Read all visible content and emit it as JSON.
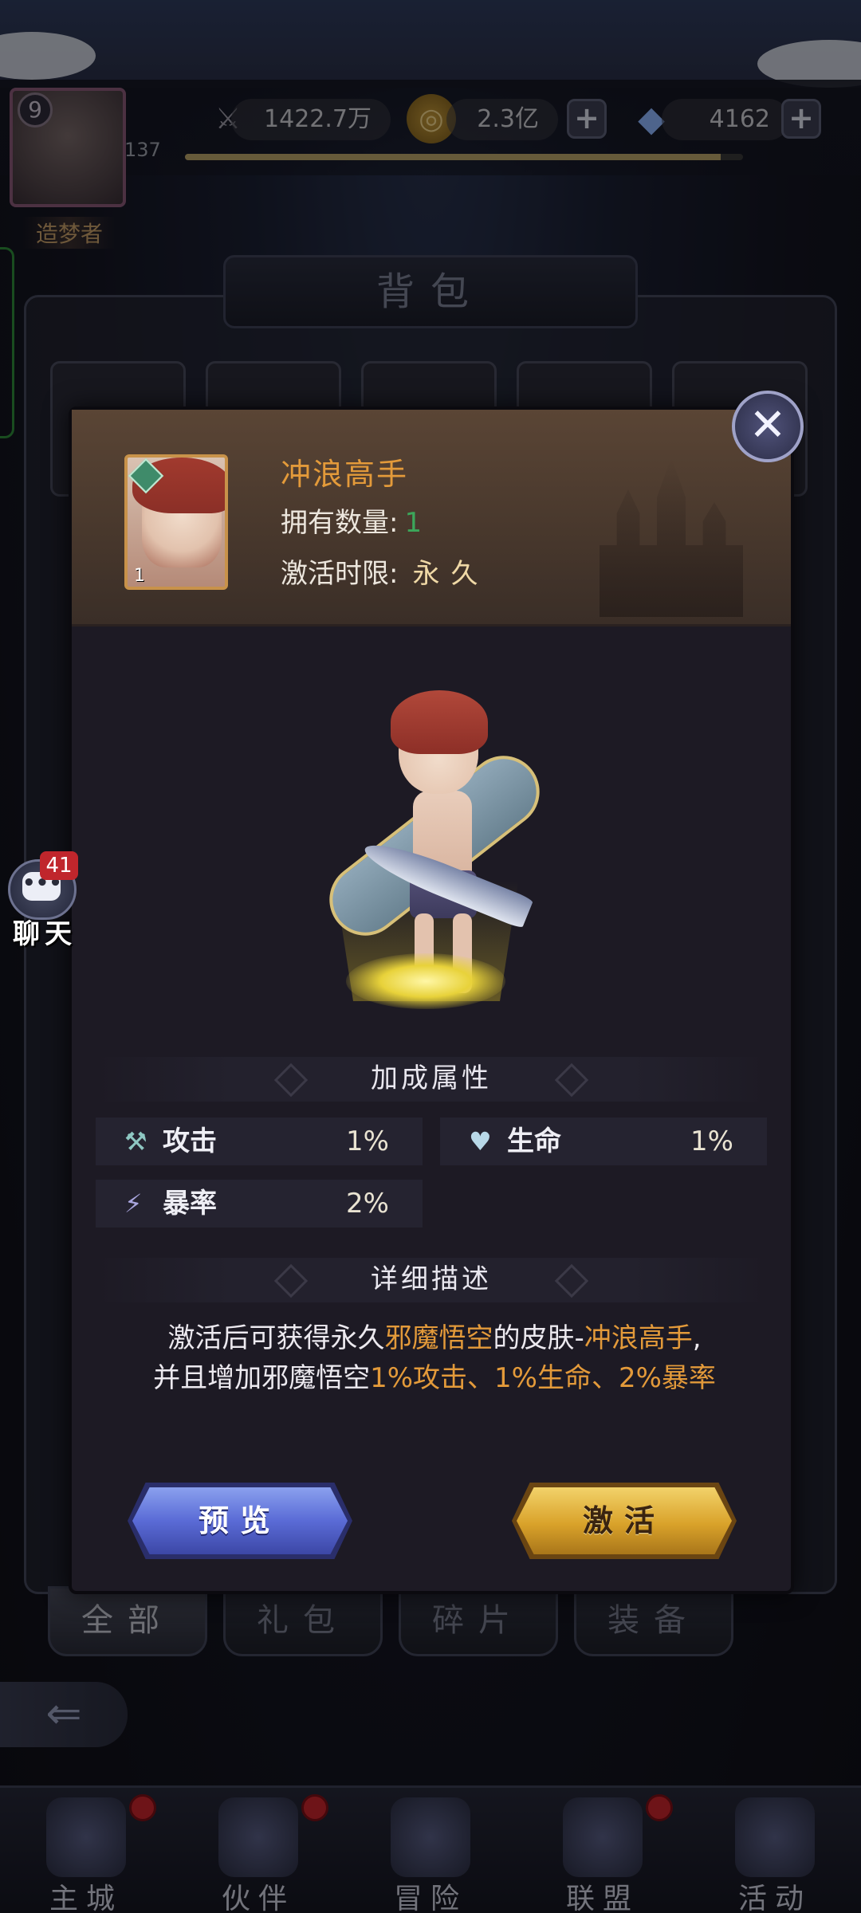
{
  "top_bar": {
    "level": "9",
    "exp_value": "137",
    "exp_progress": 0.96,
    "title_label": "造梦者",
    "power_value": "1422.7万",
    "gold_value": "2.3亿",
    "gem_value": "4162",
    "plus_symbol": "+"
  },
  "bag": {
    "title": "背包",
    "tabs": [
      "全部",
      "礼包",
      "碎片",
      "装备"
    ],
    "back_symbol": "⇐"
  },
  "chat": {
    "badge": "41",
    "label": "聊天",
    "glyph": "•••"
  },
  "modal": {
    "close_symbol": "✕",
    "item_name": "冲浪高手",
    "item_count": "1",
    "own_label": "拥有数量:",
    "own_value": "1",
    "limit_label": "激活时限:",
    "limit_value": "永久",
    "attr_section_title": "加成属性",
    "stats": [
      {
        "label": "攻击",
        "value": "1%",
        "icon": "sword-icon"
      },
      {
        "label": "生命",
        "value": "1%",
        "icon": "heart-icon"
      },
      {
        "label": "暴率",
        "value": "2%",
        "icon": "lightning-icon"
      }
    ],
    "desc_section_title": "详细描述",
    "desc": {
      "p1": "激活后可获得永久",
      "hero": "邪魔悟空",
      "p2": "的皮肤-",
      "skin": "冲浪高手",
      "p3": ",",
      "p4": "并且增加邪魔悟空",
      "bonus": "1%攻击、1%生命、2%暴率"
    },
    "preview_label": "预览",
    "activate_label": "激活"
  },
  "bottom_nav": {
    "items": [
      "主城",
      "伙伴",
      "冒险",
      "联盟",
      "活动"
    ]
  },
  "colors": {
    "accent_orange": "#e39a3a",
    "own_green": "#3ca65a",
    "preview_blue": "#5a6bd6",
    "activate_gold": "#d9a22a"
  }
}
